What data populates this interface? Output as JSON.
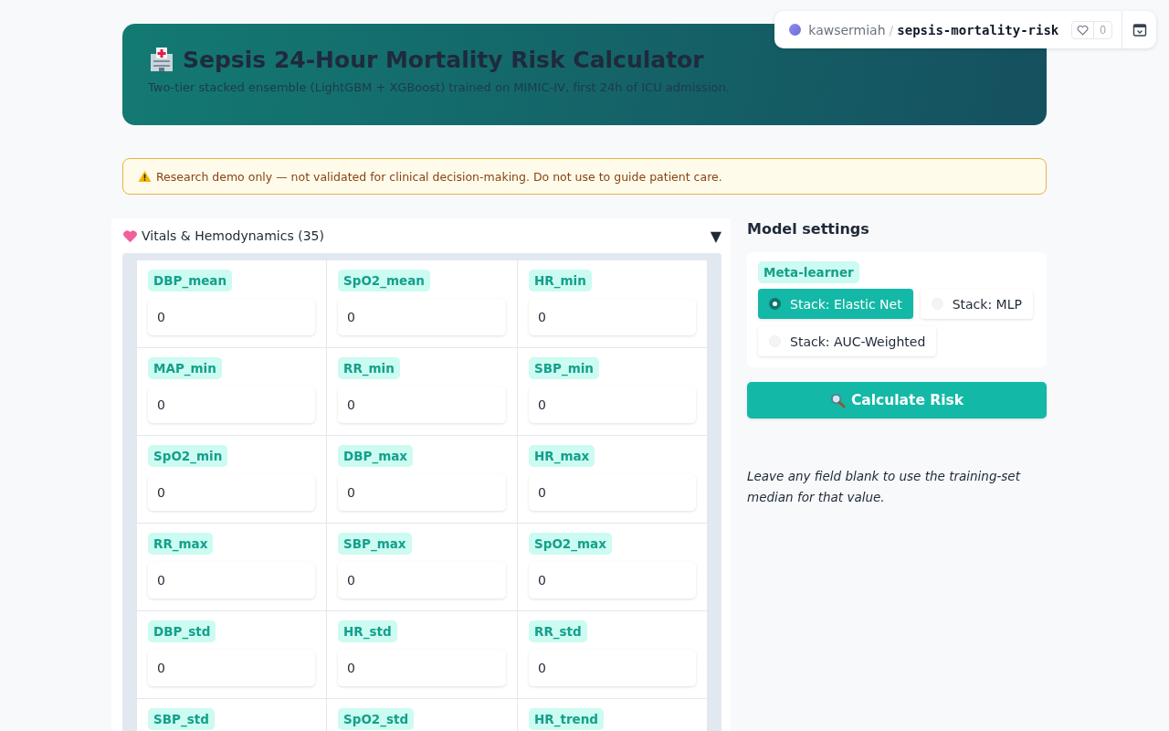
{
  "space_badge": {
    "owner": "kawsermiah",
    "separator": "/",
    "repo": "sepsis-mortality-risk",
    "likes": "0"
  },
  "header": {
    "title": "Sepsis 24-Hour Mortality Risk Calculator",
    "subtitle": "Two-tier stacked ensemble (LightGBM + XGBoost) trained on MIMIC-IV, first 24h of ICU admission."
  },
  "warning": "Research demo only — not validated for clinical decision-making. Do not use to guide patient care.",
  "section": {
    "title": "Vitals & Hemodynamics (35)",
    "expanded": true,
    "toggle": "▼",
    "fields": [
      {
        "label": "DBP_mean",
        "value": "0"
      },
      {
        "label": "SpO2_mean",
        "value": "0"
      },
      {
        "label": "HR_min",
        "value": "0"
      },
      {
        "label": "MAP_min",
        "value": "0"
      },
      {
        "label": "RR_min",
        "value": "0"
      },
      {
        "label": "SBP_min",
        "value": "0"
      },
      {
        "label": "SpO2_min",
        "value": "0"
      },
      {
        "label": "DBP_max",
        "value": "0"
      },
      {
        "label": "HR_max",
        "value": "0"
      },
      {
        "label": "RR_max",
        "value": "0"
      },
      {
        "label": "SBP_max",
        "value": "0"
      },
      {
        "label": "SpO2_max",
        "value": "0"
      },
      {
        "label": "DBP_std",
        "value": "0"
      },
      {
        "label": "HR_std",
        "value": "0"
      },
      {
        "label": "RR_std",
        "value": "0"
      },
      {
        "label": "SBP_std"
      },
      {
        "label": "SpO2_std"
      },
      {
        "label": "HR_trend"
      }
    ]
  },
  "settings": {
    "title": "Model settings",
    "group_label": "Meta-learner",
    "options": [
      {
        "label": "Stack: Elastic Net",
        "selected": true
      },
      {
        "label": "Stack: MLP",
        "selected": false
      },
      {
        "label": "Stack: AUC-Weighted",
        "selected": false
      }
    ],
    "button": "Calculate Risk",
    "note": "Leave any field blank to use the training-set median for that value."
  }
}
